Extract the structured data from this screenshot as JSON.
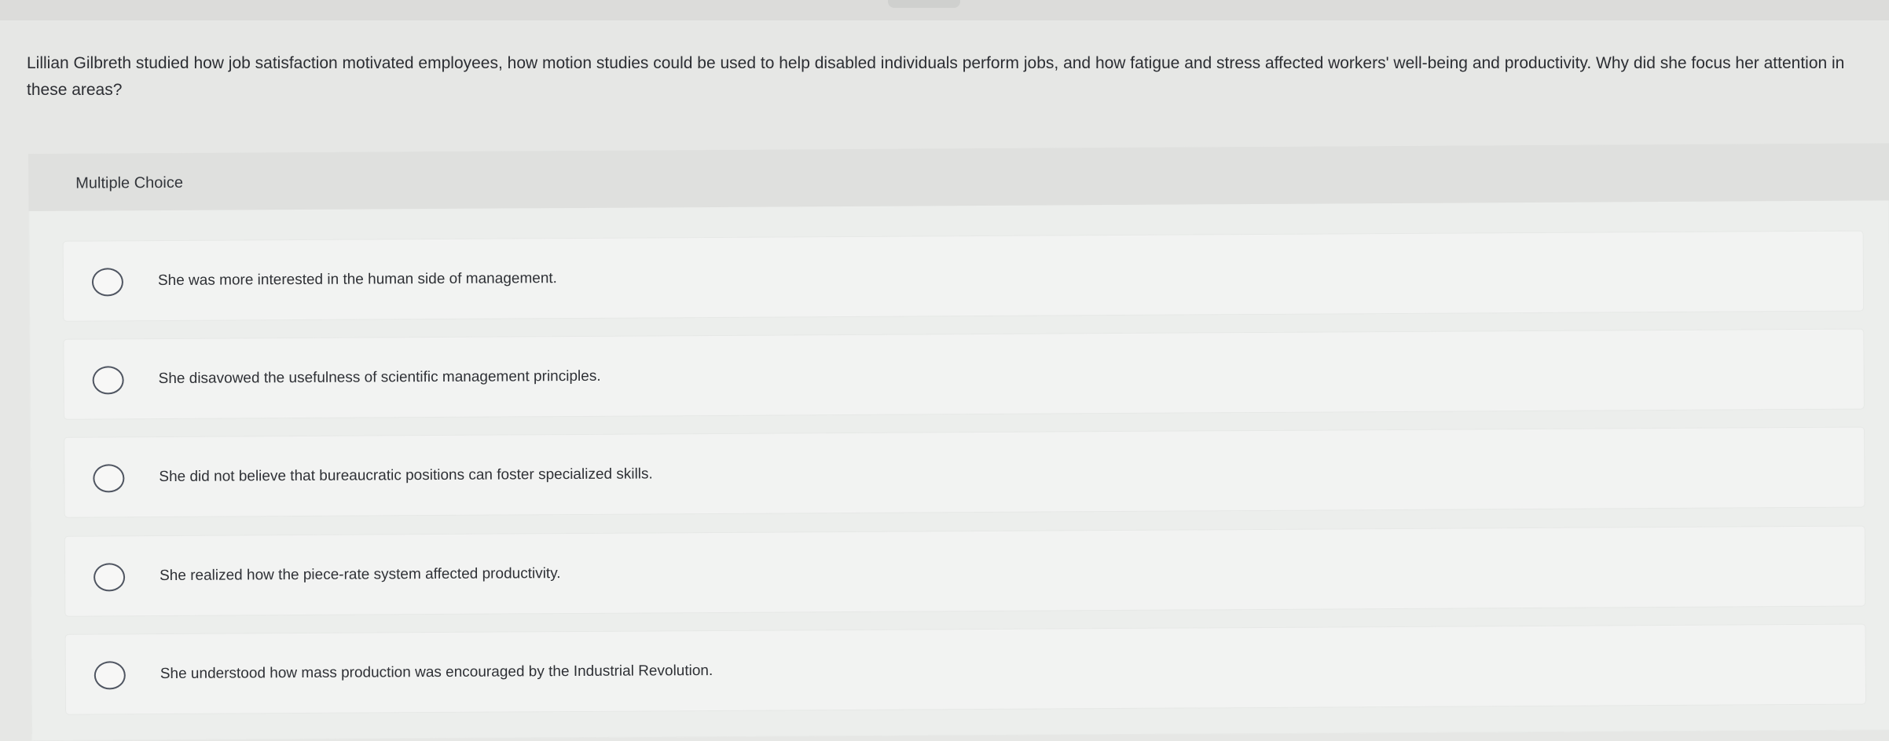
{
  "question": {
    "text": "Lillian Gilbreth studied how job satisfaction motivated employees, how motion studies could be used to help disabled individuals perform jobs, and how fatigue and stress affected workers' well-being and productivity. Why did she focus her attention in these areas?"
  },
  "multiple_choice": {
    "label": "Multiple Choice",
    "options": [
      {
        "label": "She was more interested in the human side of management."
      },
      {
        "label": "She disavowed the usefulness of scientific management principles."
      },
      {
        "label": "She did not believe that bureaucratic positions can foster specialized skills."
      },
      {
        "label": "She realized how the piece-rate system affected productivity."
      },
      {
        "label": "She understood how mass production was encouraged by the Industrial Revolution."
      }
    ]
  }
}
